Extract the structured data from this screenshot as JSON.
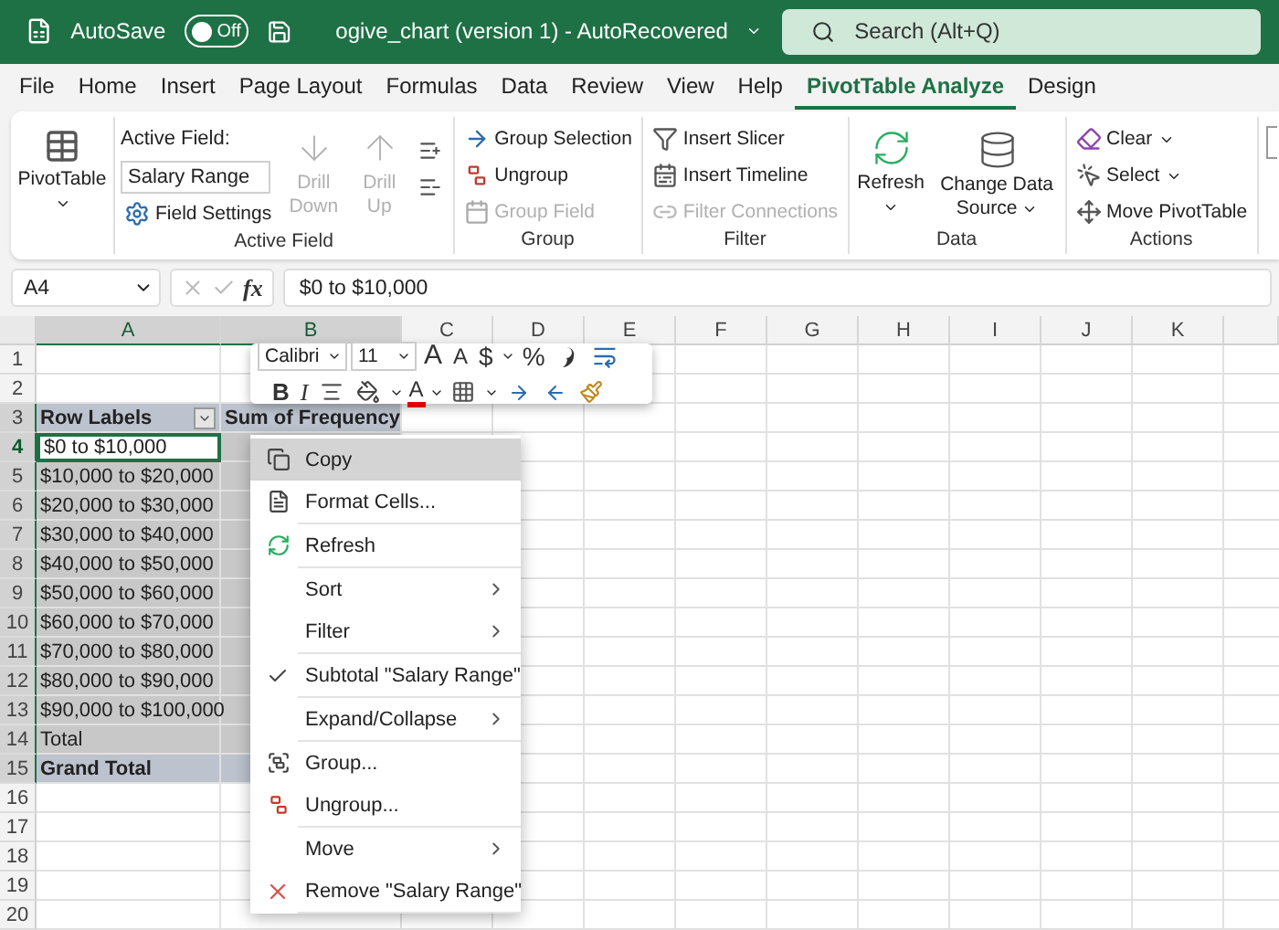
{
  "title_bar": {
    "autosave_label": "AutoSave",
    "autosave_toggle": {
      "label": "Off",
      "on": false
    },
    "document_title": "ogive_chart (version 1)  -  AutoRecovered",
    "search": {
      "placeholder": "Search (Alt+Q)"
    }
  },
  "tabs": [
    {
      "label": "File",
      "selected": false
    },
    {
      "label": "Home",
      "selected": false
    },
    {
      "label": "Insert",
      "selected": false
    },
    {
      "label": "Page Layout",
      "selected": false
    },
    {
      "label": "Formulas",
      "selected": false
    },
    {
      "label": "Data",
      "selected": false
    },
    {
      "label": "Review",
      "selected": false
    },
    {
      "label": "View",
      "selected": false
    },
    {
      "label": "Help",
      "selected": false
    },
    {
      "label": "PivotTable Analyze",
      "selected": true
    },
    {
      "label": "Design",
      "selected": false
    }
  ],
  "ribbon": {
    "pivottable": {
      "label": "PivotTable"
    },
    "active_field": {
      "caption": "Active Field:",
      "field_value": "Salary Range",
      "field_settings": {
        "label": "Field Settings",
        "disabled": false
      },
      "drill_down": {
        "label": "Drill Down",
        "disabled": true
      },
      "drill_up": {
        "label": "Drill Up",
        "disabled": true
      },
      "group_label": "Active Field"
    },
    "group": {
      "group_label": "Group",
      "items": [
        {
          "label": "Group Selection",
          "disabled": false
        },
        {
          "label": "Ungroup",
          "disabled": false
        },
        {
          "label": "Group Field",
          "disabled": true
        }
      ]
    },
    "filter": {
      "group_label": "Filter",
      "items": [
        {
          "label": "Insert Slicer",
          "disabled": false
        },
        {
          "label": "Insert Timeline",
          "disabled": false
        },
        {
          "label": "Filter Connections",
          "disabled": true
        }
      ]
    },
    "data": {
      "group_label": "Data",
      "items": [
        {
          "label": "Refresh"
        },
        {
          "label": "Change Data Source"
        }
      ]
    },
    "actions": {
      "group_label": "Actions",
      "items": [
        {
          "label": "Clear",
          "dropdown": true
        },
        {
          "label": "Select",
          "dropdown": true
        },
        {
          "label": "Move PivotTable",
          "dropdown": false
        }
      ]
    }
  },
  "formula_bar": {
    "name_box": "A4",
    "function_label": "fx",
    "value": "$0 to $10,000"
  },
  "sheet": {
    "columns": [
      {
        "label": "A",
        "selected": true
      },
      {
        "label": "B",
        "selected": true
      },
      {
        "label": "C",
        "selected": false
      },
      {
        "label": "D",
        "selected": false
      },
      {
        "label": "E",
        "selected": false
      },
      {
        "label": "F",
        "selected": false
      },
      {
        "label": "G",
        "selected": false
      },
      {
        "label": "H",
        "selected": false
      },
      {
        "label": "I",
        "selected": false
      },
      {
        "label": "J",
        "selected": false
      },
      {
        "label": "K",
        "selected": false
      }
    ],
    "rows": [
      {
        "header": "1",
        "kind": "blank",
        "selected": false,
        "active": false
      },
      {
        "header": "2",
        "kind": "blank",
        "selected": false,
        "active": false
      },
      {
        "header": "3",
        "kind": "pivot_header",
        "label": "Row Labels",
        "value": "Sum of Frequency",
        "selected": true,
        "active": false
      },
      {
        "header": "4",
        "kind": "item",
        "label": "$0 to $10,000",
        "selected": true,
        "active": true
      },
      {
        "header": "5",
        "kind": "item",
        "label": "$10,000 to $20,000",
        "selected": true,
        "active": false
      },
      {
        "header": "6",
        "kind": "item",
        "label": "$20,000 to $30,000",
        "selected": true,
        "active": false
      },
      {
        "header": "7",
        "kind": "item",
        "label": "$30,000 to $40,000",
        "selected": true,
        "active": false
      },
      {
        "header": "8",
        "kind": "item",
        "label": "$40,000 to $50,000",
        "selected": true,
        "active": false
      },
      {
        "header": "9",
        "kind": "item",
        "label": "$50,000 to $60,000",
        "selected": true,
        "active": false
      },
      {
        "header": "10",
        "kind": "item",
        "label": "$60,000 to $70,000",
        "selected": true,
        "active": false
      },
      {
        "header": "11",
        "kind": "item",
        "label": "$70,000 to $80,000",
        "selected": true,
        "active": false
      },
      {
        "header": "12",
        "kind": "item",
        "label": "$80,000 to $90,000",
        "selected": true,
        "active": false
      },
      {
        "header": "13",
        "kind": "item",
        "label": "$90,000 to $100,000",
        "selected": true,
        "active": false
      },
      {
        "header": "14",
        "kind": "item",
        "label": "Total",
        "selected": true,
        "active": false
      },
      {
        "header": "15",
        "kind": "grand_total",
        "label": "Grand Total",
        "selected": true,
        "active": false
      },
      {
        "header": "16",
        "kind": "blank",
        "selected": false,
        "active": false
      },
      {
        "header": "17",
        "kind": "blank",
        "selected": false,
        "active": false
      },
      {
        "header": "18",
        "kind": "blank",
        "selected": false,
        "active": false
      },
      {
        "header": "19",
        "kind": "blank",
        "selected": false,
        "active": false
      },
      {
        "header": "20",
        "kind": "blank",
        "selected": false,
        "active": false
      }
    ]
  },
  "mini_toolbar": {
    "font": "Calibri",
    "size": "11",
    "grow_font": "A",
    "shrink_font": "A",
    "currency": "$",
    "percent": "%",
    "bold": "B",
    "italic": "I",
    "font_color": "A"
  },
  "context_menu": {
    "items": [
      {
        "label": "Copy",
        "selected": true,
        "checked": false,
        "submenu": false,
        "divider_after": false
      },
      {
        "label": "Format Cells...",
        "selected": false,
        "checked": false,
        "submenu": false,
        "divider_after": true
      },
      {
        "label": "Refresh",
        "selected": false,
        "checked": false,
        "submenu": false,
        "divider_after": true
      },
      {
        "label": "Sort",
        "selected": false,
        "checked": false,
        "submenu": true,
        "divider_after": false
      },
      {
        "label": "Filter",
        "selected": false,
        "checked": false,
        "submenu": true,
        "divider_after": true
      },
      {
        "label": "Subtotal \"Salary Range\"",
        "selected": false,
        "checked": true,
        "submenu": false,
        "divider_after": true
      },
      {
        "label": "Expand/Collapse",
        "selected": false,
        "checked": false,
        "submenu": true,
        "divider_after": true
      },
      {
        "label": "Group...",
        "selected": false,
        "checked": false,
        "submenu": false,
        "divider_after": false
      },
      {
        "label": "Ungroup...",
        "selected": false,
        "checked": false,
        "submenu": false,
        "divider_after": true
      },
      {
        "label": "Move",
        "selected": false,
        "checked": false,
        "submenu": true,
        "divider_after": false
      },
      {
        "label": "Remove \"Salary Range\"",
        "selected": false,
        "checked": false,
        "submenu": false,
        "divider_after": true
      }
    ]
  }
}
